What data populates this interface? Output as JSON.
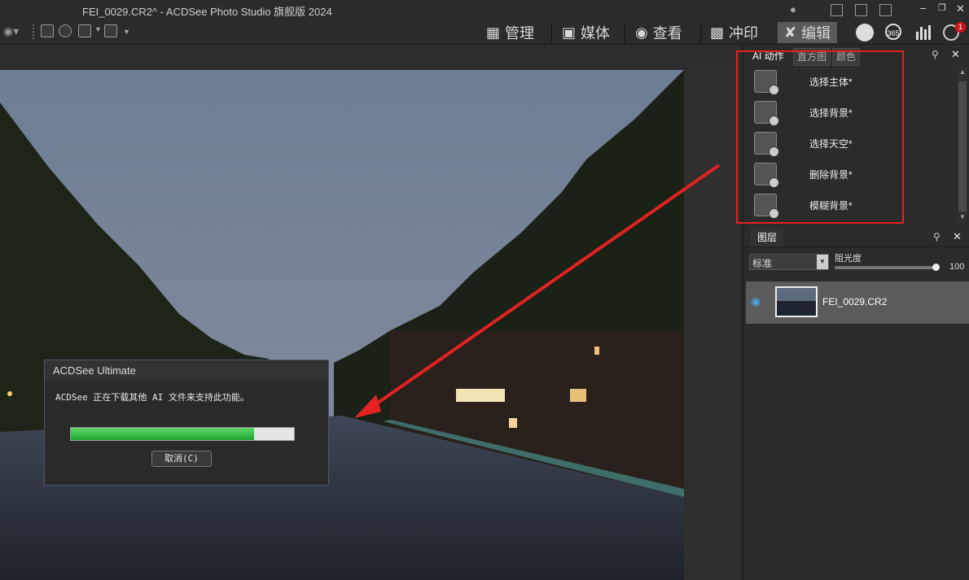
{
  "window": {
    "title": "FEI_0029.CR2^ - ACDSee Photo Studio 旗舰版 2024",
    "controls": [
      "minimize",
      "restore",
      "close"
    ]
  },
  "modes": [
    {
      "label": "管理",
      "icon": "grid-icon"
    },
    {
      "label": "媒体",
      "icon": "media-icon"
    },
    {
      "label": "查看",
      "icon": "eye-icon"
    },
    {
      "label": "冲印",
      "icon": "develop-icon"
    },
    {
      "label": "编辑",
      "icon": "edit-icon",
      "active": true
    }
  ],
  "extra_icons": {
    "badge_365": "365",
    "notify_count": "1"
  },
  "ai_panel": {
    "tabs": [
      {
        "label": "AI 动作",
        "active": true
      },
      {
        "label": "直方图"
      },
      {
        "label": "颜色"
      }
    ],
    "items": [
      {
        "label": "选择主体*",
        "icon": "select-subject-icon"
      },
      {
        "label": "选择背景*",
        "icon": "select-background-icon"
      },
      {
        "label": "选择天空*",
        "icon": "select-sky-icon"
      },
      {
        "label": "删除背景*",
        "icon": "remove-background-icon"
      },
      {
        "label": "模糊背景*",
        "icon": "blur-background-icon"
      }
    ]
  },
  "layers_panel": {
    "tab": "图层",
    "blend_mode": "标准",
    "opacity_label": "阻光度",
    "opacity_value": "100",
    "layer_name": "FEI_0029.CR2"
  },
  "dialog": {
    "title": "ACDSee Ultimate",
    "message": "ACDSee 正在下载其他 AI 文件来支持此功能。",
    "progress": 0.82,
    "cancel_label": "取消(C)"
  },
  "colors": {
    "accent_red": "#e32222",
    "progress_green": "#2ebd3d"
  }
}
